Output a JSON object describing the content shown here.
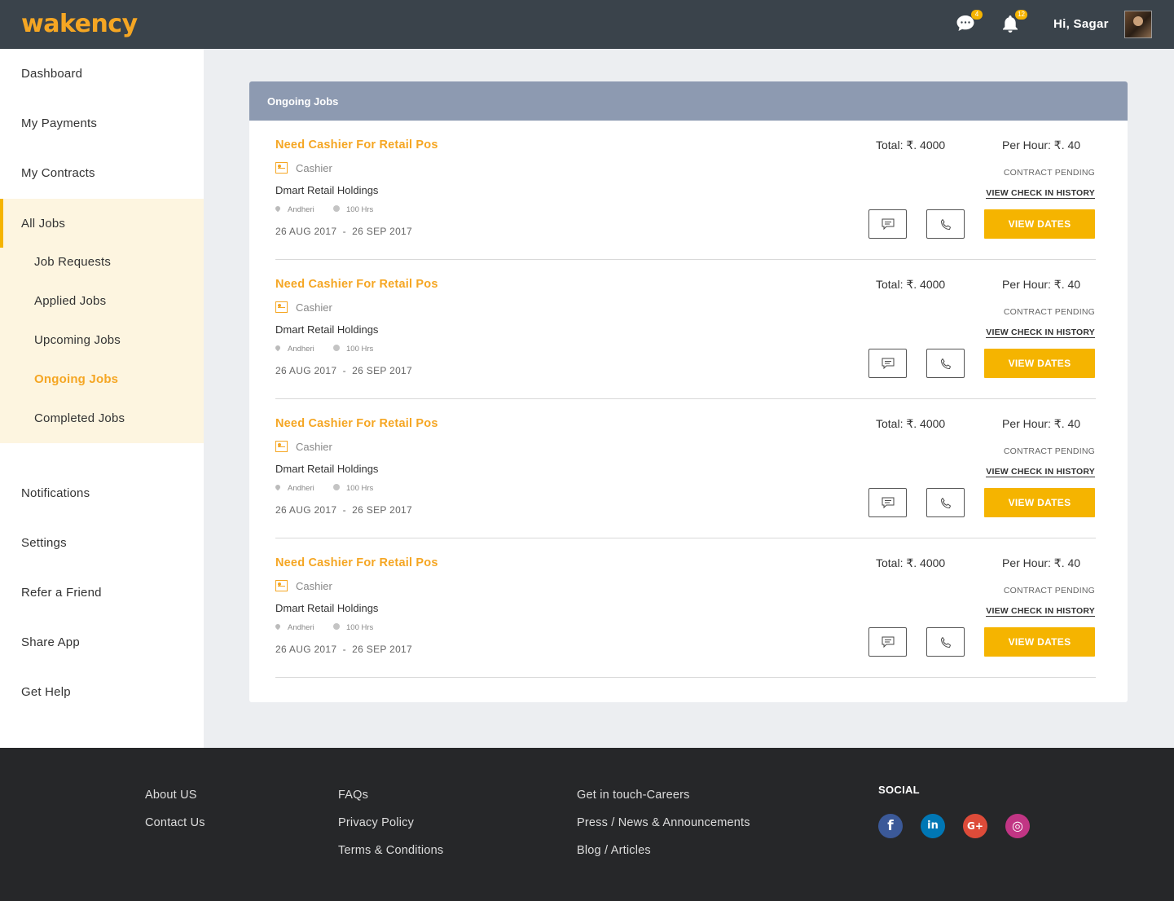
{
  "header": {
    "logo": "wakency",
    "messages_badge": "4",
    "notifications_badge": "12",
    "greeting": "Hi, Sagar"
  },
  "sidebar": {
    "items": [
      {
        "label": "Dashboard"
      },
      {
        "label": "My Payments"
      },
      {
        "label": "My Contracts"
      },
      {
        "label": "All Jobs"
      },
      {
        "label": "Notifications"
      },
      {
        "label": "Settings"
      },
      {
        "label": "Refer a Friend"
      },
      {
        "label": "Share App"
      },
      {
        "label": "Get Help"
      }
    ],
    "sub_items": [
      {
        "label": "Job Requests"
      },
      {
        "label": "Applied Jobs"
      },
      {
        "label": "Upcoming Jobs"
      },
      {
        "label": "Ongoing Jobs"
      },
      {
        "label": "Completed Jobs"
      }
    ],
    "active_sub_item": "Ongoing Jobs"
  },
  "main": {
    "title": "Ongoing Jobs",
    "jobs": [
      {
        "title": "Need Cashier For Retail Pos",
        "role": "Cashier",
        "company": "Dmart Retail Holdings",
        "location": "Andheri",
        "hours": "100 Hrs",
        "dates": "26 AUG 2017  -  26 SEP 2017",
        "total": "Total: ₹. 4000",
        "rate": "Per Hour: ₹. 40",
        "status": "CONTRACT PENDING",
        "history_link": "VIEW CHECK IN HISTORY",
        "view_dates": "VIEW DATES"
      },
      {
        "title": "Need Cashier For Retail Pos",
        "role": "Cashier",
        "company": "Dmart Retail Holdings",
        "location": "Andheri",
        "hours": "100 Hrs",
        "dates": "26 AUG 2017  -  26 SEP 2017",
        "total": "Total: ₹. 4000",
        "rate": "Per Hour: ₹. 40",
        "status": "CONTRACT PENDING",
        "history_link": "VIEW CHECK IN HISTORY",
        "view_dates": "VIEW DATES"
      },
      {
        "title": "Need Cashier For Retail Pos",
        "role": "Cashier",
        "company": "Dmart Retail Holdings",
        "location": "Andheri",
        "hours": "100 Hrs",
        "dates": "26 AUG 2017  -  26 SEP 2017",
        "total": "Total: ₹. 4000",
        "rate": "Per Hour: ₹. 40",
        "status": "CONTRACT PENDING",
        "history_link": "VIEW CHECK IN HISTORY",
        "view_dates": "VIEW DATES"
      },
      {
        "title": "Need Cashier For Retail Pos",
        "role": "Cashier",
        "company": "Dmart Retail Holdings",
        "location": "Andheri",
        "hours": "100 Hrs",
        "dates": "26 AUG 2017  -  26 SEP 2017",
        "total": "Total: ₹. 4000",
        "rate": "Per Hour: ₹. 40",
        "status": "CONTRACT PENDING",
        "history_link": "VIEW CHECK IN HISTORY",
        "view_dates": "VIEW DATES"
      }
    ]
  },
  "footer": {
    "col1": [
      "About US",
      "Contact Us"
    ],
    "col2": [
      "FAQs",
      "Privacy Policy",
      "Terms & Conditions"
    ],
    "col3": [
      "Get in touch-Careers",
      "Press / News & Announcements",
      "Blog / Articles"
    ],
    "social_title": "SOCIAL",
    "social": [
      {
        "icon": "facebook-icon",
        "glyph": "f",
        "color": "#3b5998"
      },
      {
        "icon": "linkedin-icon",
        "glyph": "in",
        "color": "#0077b5"
      },
      {
        "icon": "google-plus-icon",
        "glyph": "G+",
        "color": "#dd4b39"
      },
      {
        "icon": "instagram-icon",
        "glyph": "◎",
        "color": "#c13584"
      }
    ]
  },
  "colors": {
    "accent": "#f5b400",
    "header_bg": "#3a434b",
    "card_header_bg": "#8d9ab1",
    "footer_bg": "#262729"
  }
}
